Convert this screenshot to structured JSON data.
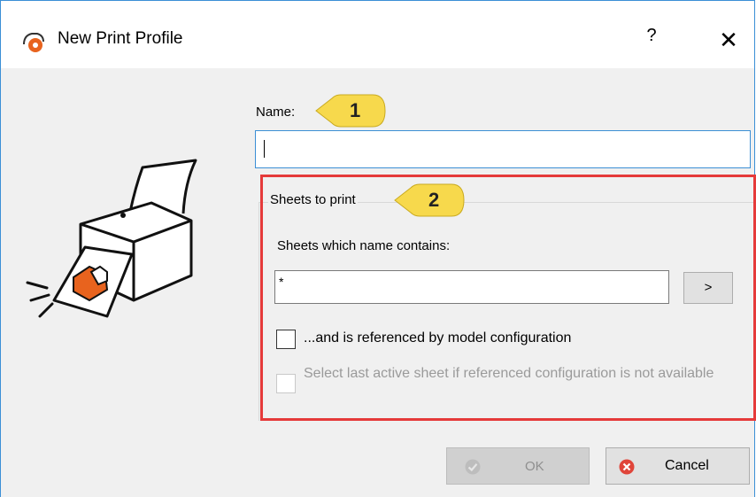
{
  "window": {
    "title": "New Print Profile",
    "help_label": "?",
    "close_label": "✕"
  },
  "name_field": {
    "label": "Name:",
    "value": ""
  },
  "sheets_group": {
    "label": "Sheets to print",
    "contains_label": "Sheets which name contains:",
    "filter_value": "*",
    "browse_label": ">",
    "referenced_checkbox": {
      "label": "...and is referenced by model configuration",
      "checked": false
    },
    "last_active_checkbox": {
      "label": "Select last active sheet if referenced configuration is not available",
      "checked": false,
      "enabled": false
    }
  },
  "buttons": {
    "ok_label": "OK",
    "cancel_label": "Cancel"
  },
  "callouts": [
    {
      "number": "1"
    },
    {
      "number": "2"
    }
  ],
  "colors": {
    "callout": "#f7d94c",
    "highlight_border": "#e53a3a",
    "accent": "#3c8fd5",
    "cancel_icon": "#e0453a",
    "printer_part": "#e8631e"
  }
}
